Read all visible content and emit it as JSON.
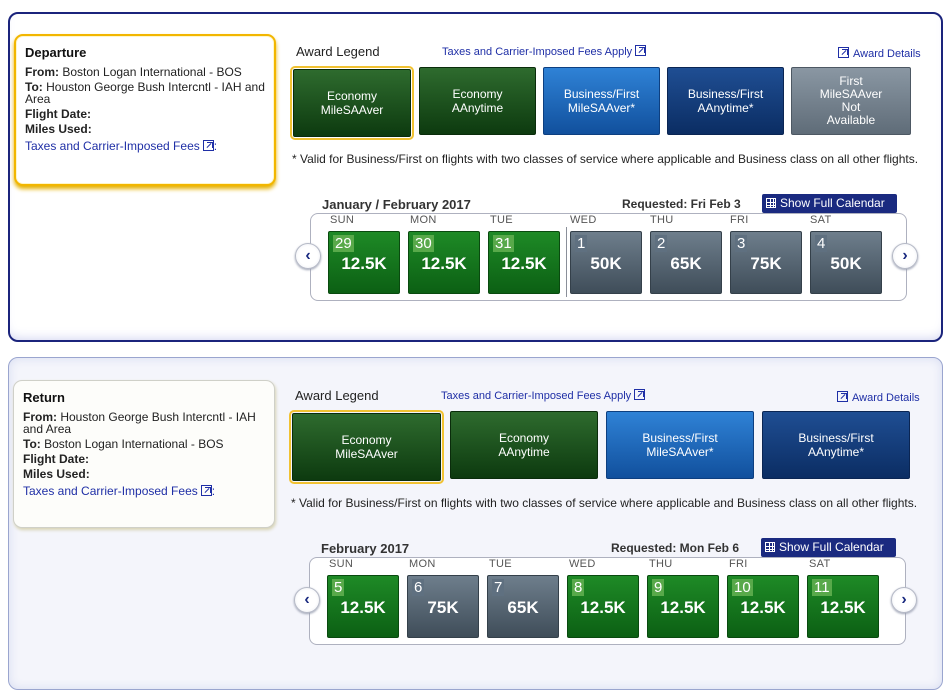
{
  "departure": {
    "title": "Departure",
    "from_label": "From:",
    "from_value": "Boston Logan International - BOS",
    "to_label": "To:",
    "to_value": "Houston George Bush Intercntl - IAH and Area",
    "flight_date_label": "Flight Date:",
    "miles_used_label": "Miles Used:",
    "taxes_link": "Taxes and Carrier-Imposed Fees",
    "legend_title": "Award Legend",
    "taxes_apply": "Taxes and Carrier-Imposed Fees Apply",
    "award_details": "Award Details",
    "legend": [
      {
        "line1": "Economy",
        "line2": "MileSAAver"
      },
      {
        "line1": "Economy",
        "line2": "AAnytime"
      },
      {
        "line1": "Business/First",
        "line2": "MileSAAver*"
      },
      {
        "line1": "Business/First",
        "line2": "AAnytime*"
      },
      {
        "line1": "First",
        "line2": "MileSAAver",
        "line3": "Not",
        "line4": "Available"
      }
    ],
    "note": "* Valid for Business/First on flights with two classes of service where applicable and Business class on all other flights.",
    "calendar": {
      "month": "January / February 2017",
      "requested": "Requested: Fri Feb 3",
      "show_full": "Show Full Calendar",
      "dow": [
        "SUN",
        "MON",
        "TUE",
        "WED",
        "THU",
        "FRI",
        "SAT"
      ],
      "days": [
        {
          "num": "29",
          "miles": "12.5K",
          "type": "saver"
        },
        {
          "num": "30",
          "miles": "12.5K",
          "type": "saver"
        },
        {
          "num": "31",
          "miles": "12.5K",
          "type": "saver"
        },
        {
          "num": "1",
          "miles": "50K",
          "type": "standard"
        },
        {
          "num": "2",
          "miles": "65K",
          "type": "standard"
        },
        {
          "num": "3",
          "miles": "75K",
          "type": "standard"
        },
        {
          "num": "4",
          "miles": "50K",
          "type": "standard"
        }
      ]
    }
  },
  "return": {
    "title": "Return",
    "from_label": "From:",
    "from_value": "Houston George Bush Intercntl - IAH and Area",
    "to_label": "To:",
    "to_value": "Boston Logan International - BOS",
    "flight_date_label": "Flight Date:",
    "miles_used_label": "Miles Used:",
    "taxes_link": "Taxes and Carrier-Imposed Fees",
    "legend_title": "Award Legend",
    "taxes_apply": "Taxes and Carrier-Imposed Fees Apply",
    "award_details": "Award Details",
    "legend": [
      {
        "line1": "Economy",
        "line2": "MileSAAver"
      },
      {
        "line1": "Economy",
        "line2": "AAnytime"
      },
      {
        "line1": "Business/First",
        "line2": "MileSAAver*"
      },
      {
        "line1": "Business/First",
        "line2": "AAnytime*"
      }
    ],
    "note": "* Valid for Business/First on flights with two classes of service where applicable and Business class on all other flights.",
    "calendar": {
      "month": "February 2017",
      "requested": "Requested: Mon Feb 6",
      "show_full": "Show Full Calendar",
      "dow": [
        "SUN",
        "MON",
        "TUE",
        "WED",
        "THU",
        "FRI",
        "SAT"
      ],
      "days": [
        {
          "num": "5",
          "miles": "12.5K",
          "type": "saver"
        },
        {
          "num": "6",
          "miles": "75K",
          "type": "standard"
        },
        {
          "num": "7",
          "miles": "65K",
          "type": "standard"
        },
        {
          "num": "8",
          "miles": "12.5K",
          "type": "saver"
        },
        {
          "num": "9",
          "miles": "12.5K",
          "type": "saver"
        },
        {
          "num": "10",
          "miles": "12.5K",
          "type": "saver"
        },
        {
          "num": "11",
          "miles": "12.5K",
          "type": "saver"
        }
      ]
    }
  },
  "colors": {
    "saver_green": "#1e8a26",
    "standard_slate": "#5f6c78",
    "brand_navy": "#1a2a80",
    "highlight_gold": "#f2b600"
  }
}
